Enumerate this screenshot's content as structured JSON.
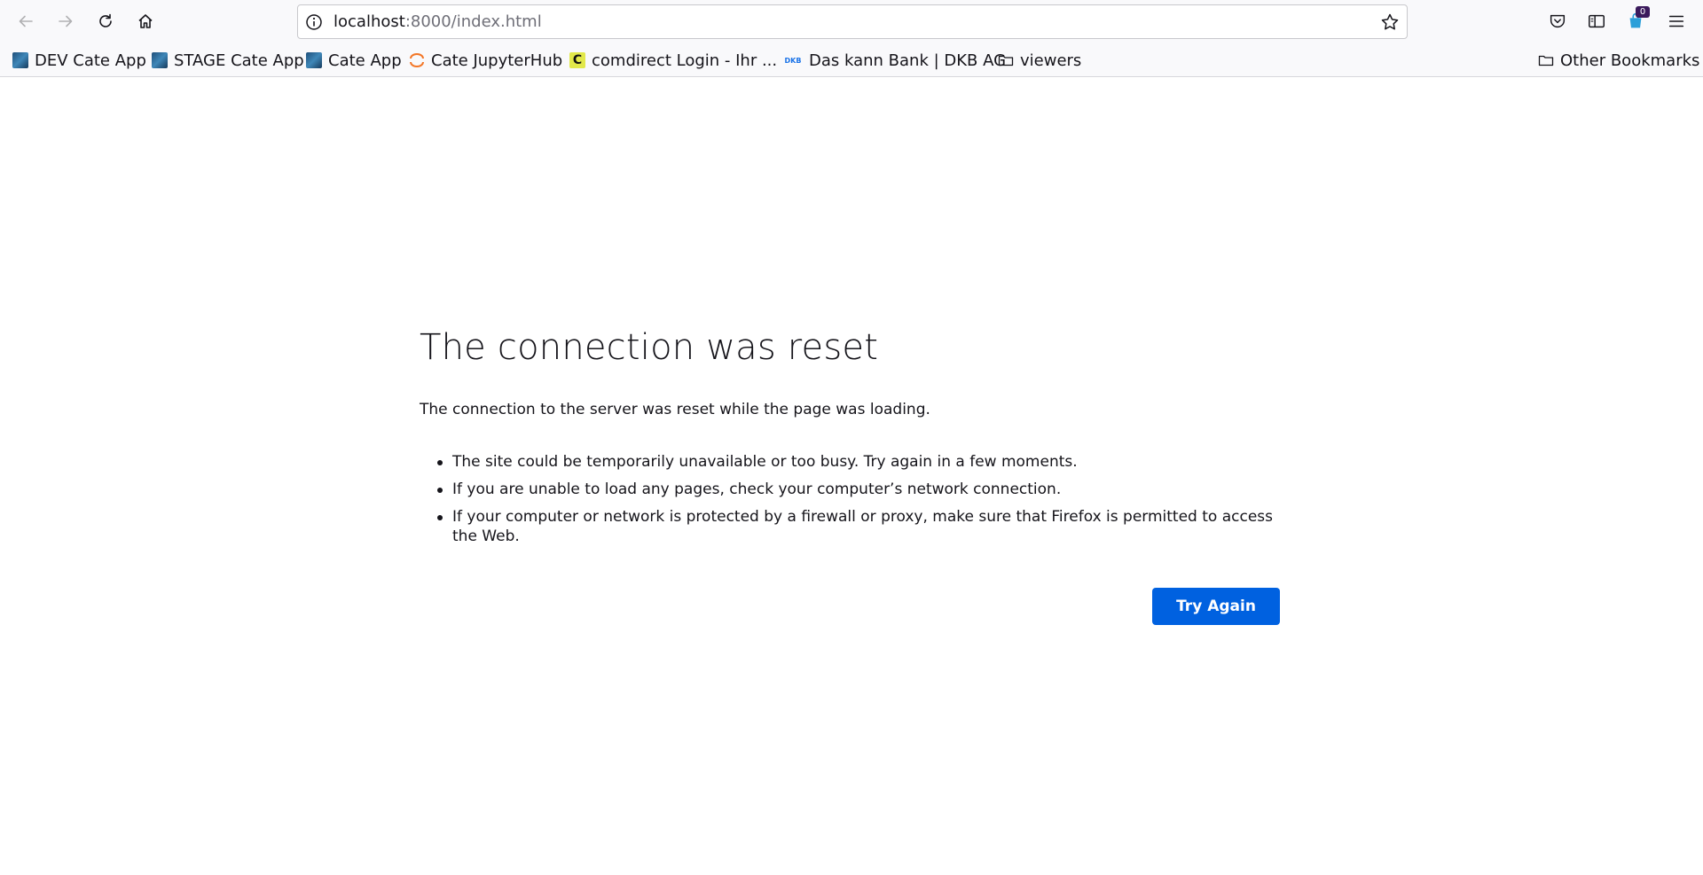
{
  "browser": {
    "url_host": "localhost",
    "url_rest": ":8000/index.html",
    "extension_badge": "0"
  },
  "bookmarks": [
    {
      "label": "DEV Cate App",
      "icon": "cate-app-icon"
    },
    {
      "label": "STAGE Cate App",
      "icon": "cate-app-icon"
    },
    {
      "label": "Cate App",
      "icon": "cate-app-icon"
    },
    {
      "label": "Cate JupyterHub",
      "icon": "jupyter-icon"
    },
    {
      "label": "comdirect Login - Ihr ...",
      "icon": "comdirect-icon"
    },
    {
      "label": "Das kann Bank | DKB AG",
      "icon": "dkb-icon"
    },
    {
      "label": "viewers",
      "icon": "folder-icon"
    }
  ],
  "other_bookmarks": "Other Bookmarks",
  "dkb_icon_text": "DKB",
  "comdirect_icon_text": "C",
  "error": {
    "title": "The connection was reset",
    "description": "The connection to the server was reset while the page was loading.",
    "items": [
      "The site could be temporarily unavailable or too busy. Try again in a few moments.",
      "If you are unable to load any pages, check your computer’s network connection.",
      "If your computer or network is protected by a firewall or proxy, make sure that Firefox is permitted to access the Web."
    ],
    "button": "Try Again"
  }
}
